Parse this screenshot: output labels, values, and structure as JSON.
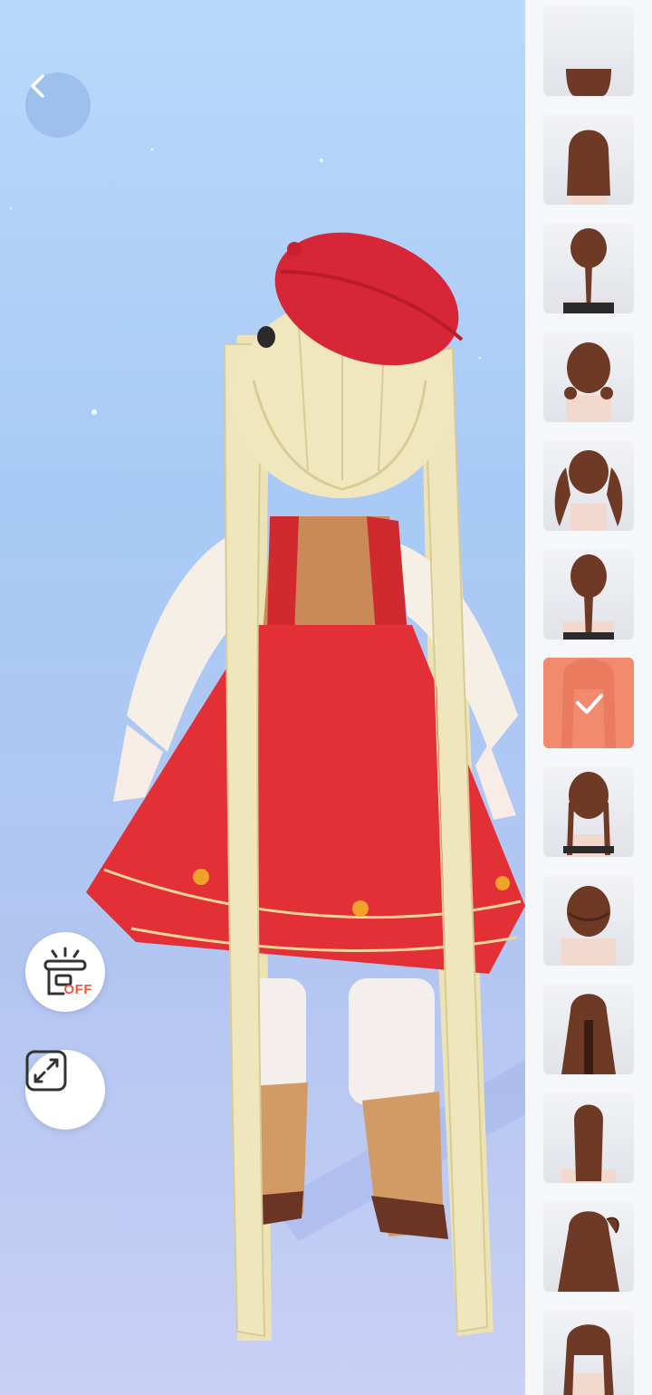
{
  "toolbar": {
    "back_icon": "chevron-left-icon",
    "lighting_toggle": {
      "icon": "lamp-icon",
      "label": "OFF"
    },
    "fullscreen_icon": "expand-arrows-icon"
  },
  "hair_list": {
    "selected_index": 6,
    "items": [
      {
        "name": "hair-style-1",
        "style": "bob"
      },
      {
        "name": "hair-style-2",
        "style": "half-up"
      },
      {
        "name": "hair-style-3",
        "style": "low-ponytail"
      },
      {
        "name": "hair-style-4",
        "style": "twin-buns"
      },
      {
        "name": "hair-style-5",
        "style": "curly-pigtails"
      },
      {
        "name": "hair-style-6",
        "style": "single-braid"
      },
      {
        "name": "hair-style-7",
        "style": "long-twintails",
        "selected": true
      },
      {
        "name": "hair-style-8",
        "style": "twin-braids"
      },
      {
        "name": "hair-style-9",
        "style": "crown-braid"
      },
      {
        "name": "hair-style-10",
        "style": "long-half-up"
      },
      {
        "name": "hair-style-11",
        "style": "long-straight"
      },
      {
        "name": "hair-style-12",
        "style": "side-ponytail"
      },
      {
        "name": "hair-style-13",
        "style": "long-layered"
      }
    ]
  },
  "colors": {
    "selected_tile": "#f28a6e",
    "off_label": "#ef5a3c",
    "hair_brown": "#6e3a26"
  }
}
